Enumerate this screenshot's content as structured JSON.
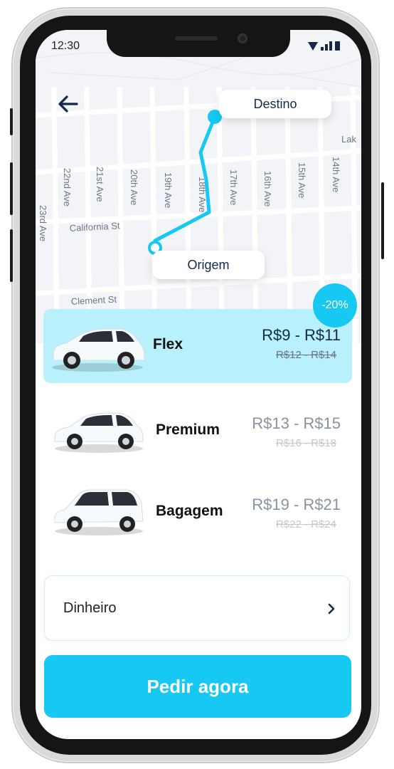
{
  "status_bar": {
    "time": "12:30"
  },
  "map": {
    "destination_label": "Destino",
    "origin_label": "Origem",
    "street_names": [
      "22nd Ave",
      "21st Ave",
      "20th Ave",
      "19th Ave",
      "18th Ave",
      "17th Ave",
      "16th Ave",
      "15th Ave",
      "14th Ave",
      "23rd Ave",
      "California St",
      "Clement St",
      "Lak"
    ]
  },
  "promo": {
    "discount_badge": "-20%"
  },
  "ride_options": [
    {
      "name": "Flex",
      "price": "R$9 - R$11",
      "old_price": "R$12 - R$14",
      "selected": true
    },
    {
      "name": "Premium",
      "price": "R$13 - R$15",
      "old_price": "R$16 - R$18",
      "selected": false
    },
    {
      "name": "Bagagem",
      "price": "R$19 - R$21",
      "old_price": "R$22 - R$24",
      "selected": false
    }
  ],
  "payment": {
    "method": "Dinheiro"
  },
  "actions": {
    "order_button": "Pedir agora"
  },
  "colors": {
    "accent": "#16c8f2",
    "selected_bg": "#b8f1fb",
    "text_dark": "#13294b",
    "route": "#16c8f2"
  },
  "icons": {
    "back": "arrow-left-icon",
    "payment_chevron": "chevron-right-icon"
  }
}
